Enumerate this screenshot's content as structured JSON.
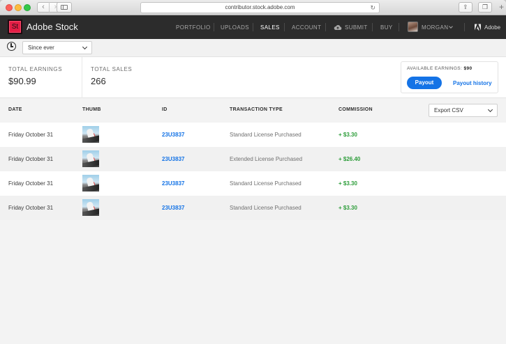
{
  "browser": {
    "url": "contributor.stock.adobe.com"
  },
  "app": {
    "logo_mark": "St",
    "title": "Adobe Stock",
    "nav": [
      "PORTFOLIO",
      "UPLOADS",
      "SALES",
      "ACCOUNT",
      "SUBMIT",
      "BUY"
    ],
    "active_nav": "SALES",
    "user": "MORGAN",
    "brand": "Adobe",
    "accent": "#1473e6",
    "brand_color": "#e31e45"
  },
  "filter": {
    "range": "Since ever"
  },
  "summary": {
    "total_earnings_label": "TOTAL EARNINGS",
    "total_earnings": "$90.99",
    "total_sales_label": "TOTAL SALES",
    "total_sales": "266",
    "available_label": "AVAILABLE EARNINGS:",
    "available_value": "$90",
    "payout_button": "Payout",
    "payout_history": "Payout history"
  },
  "table": {
    "headers": [
      "DATE",
      "THUMB",
      "ID",
      "TRANSACTION TYPE",
      "COMMISSION"
    ],
    "export": "Export CSV",
    "rows": [
      {
        "date": "Friday October 31",
        "id": "23U3837",
        "type": "Standard License Purchased",
        "commission": "+ $3.30"
      },
      {
        "date": "Friday October 31",
        "id": "23U3837",
        "type": "Extended License Purchased",
        "commission": "+ $26.40"
      },
      {
        "date": "Friday October 31",
        "id": "23U3837",
        "type": "Standard License Purchased",
        "commission": "+ $3.30"
      },
      {
        "date": "Friday October 31",
        "id": "23U3837",
        "type": "Standard License Purchased",
        "commission": "+ $3.30"
      }
    ]
  }
}
